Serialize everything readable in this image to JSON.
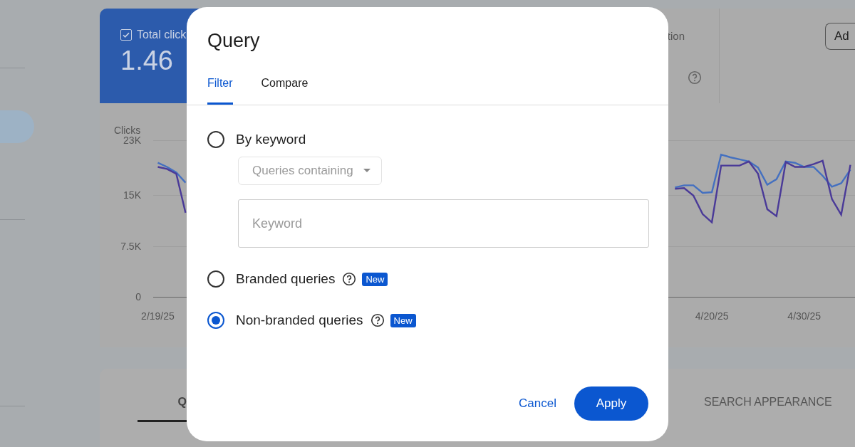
{
  "background": {
    "metric_cards": [
      {
        "kind": "selected",
        "label": "Total click",
        "value": "1.46",
        "checked": true
      },
      {
        "kind": "plain",
        "label": "tion"
      }
    ],
    "add_button": "Ad",
    "chart": {
      "title": "Clicks",
      "chart_data": {
        "type": "line",
        "ylim": [
          0,
          23
        ],
        "categories": [
          "2/19/25",
          null,
          null,
          null,
          null,
          null,
          null,
          null,
          null,
          null,
          null,
          null,
          null,
          null,
          null,
          null,
          null,
          null,
          null,
          null,
          null,
          null,
          null,
          null,
          null,
          null,
          null,
          null,
          null,
          null,
          null,
          null,
          null,
          null,
          null,
          null,
          null,
          null,
          null,
          null,
          null,
          null,
          null,
          null,
          null,
          null,
          null,
          null,
          null,
          null,
          null,
          null,
          null,
          null,
          null,
          null,
          null,
          null,
          null,
          null,
          "4/20/25",
          null,
          null,
          null,
          null,
          null,
          null,
          null,
          null,
          null,
          "4/30/25",
          null,
          null,
          null,
          null,
          null
        ],
        "yticks": [
          {
            "value": 23,
            "label": "23K"
          },
          {
            "value": 15,
            "label": "15K"
          },
          {
            "value": 7.5,
            "label": "7.5K"
          },
          {
            "value": 0,
            "label": "0"
          }
        ],
        "series": [
          {
            "color": "#4470c0",
            "values": [
              19.7,
              19.1,
              18.3,
              16.8,
              null,
              null,
              null,
              null,
              null,
              null,
              null,
              null,
              null,
              null,
              null,
              null,
              null,
              null,
              null,
              null,
              null,
              null,
              null,
              null,
              null,
              null,
              null,
              null,
              null,
              null,
              null,
              null,
              null,
              null,
              null,
              null,
              null,
              null,
              null,
              null,
              null,
              null,
              null,
              null,
              null,
              null,
              null,
              null,
              null,
              null,
              null,
              null,
              null,
              null,
              null,
              null,
              16.1,
              16.4,
              16.4,
              15.3,
              15.4,
              20.9,
              20.5,
              20.2,
              19.9,
              19.0,
              16.5,
              17.3,
              19.9,
              19.7,
              19.1,
              19.1,
              17.8,
              16.2,
              16.7,
              18.7
            ]
          },
          {
            "color": "#4a3a98",
            "values": [
              19.1,
              18.8,
              18.1,
              12.4,
              null,
              null,
              null,
              null,
              null,
              null,
              null,
              null,
              null,
              null,
              null,
              null,
              null,
              null,
              null,
              null,
              null,
              null,
              null,
              null,
              null,
              null,
              null,
              null,
              null,
              null,
              null,
              null,
              null,
              null,
              null,
              null,
              null,
              null,
              null,
              null,
              null,
              null,
              null,
              null,
              null,
              null,
              null,
              null,
              null,
              null,
              null,
              null,
              null,
              null,
              null,
              null,
              15.9,
              16.0,
              14.9,
              12.2,
              11.0,
              19.3,
              19.3,
              19.3,
              19.9,
              18.1,
              12.9,
              11.9,
              19.8,
              19.1,
              19.1,
              19.5,
              20.0,
              14.4,
              12.1,
              19.4
            ]
          }
        ]
      }
    },
    "bottom_tabs": [
      {
        "label": "Q",
        "selected": true
      },
      {
        "label": "SEARCH APPEARANCE",
        "selected": false
      }
    ]
  },
  "dialog": {
    "title": "Query",
    "tabs": [
      {
        "label": "Filter",
        "selected": true
      },
      {
        "label": "Compare",
        "selected": false
      }
    ],
    "options": [
      {
        "label": "By keyword",
        "selected": false,
        "help": false,
        "dropdown": "Queries containing",
        "placeholder": "Keyword"
      },
      {
        "label": "Branded queries",
        "selected": false,
        "help": true,
        "badge": "New"
      },
      {
        "label": "Non-branded queries",
        "selected": true,
        "help": true,
        "badge": "New"
      }
    ],
    "buttons": [
      {
        "kind": "text",
        "label": "Cancel"
      },
      {
        "kind": "filled",
        "label": "Apply"
      }
    ]
  }
}
